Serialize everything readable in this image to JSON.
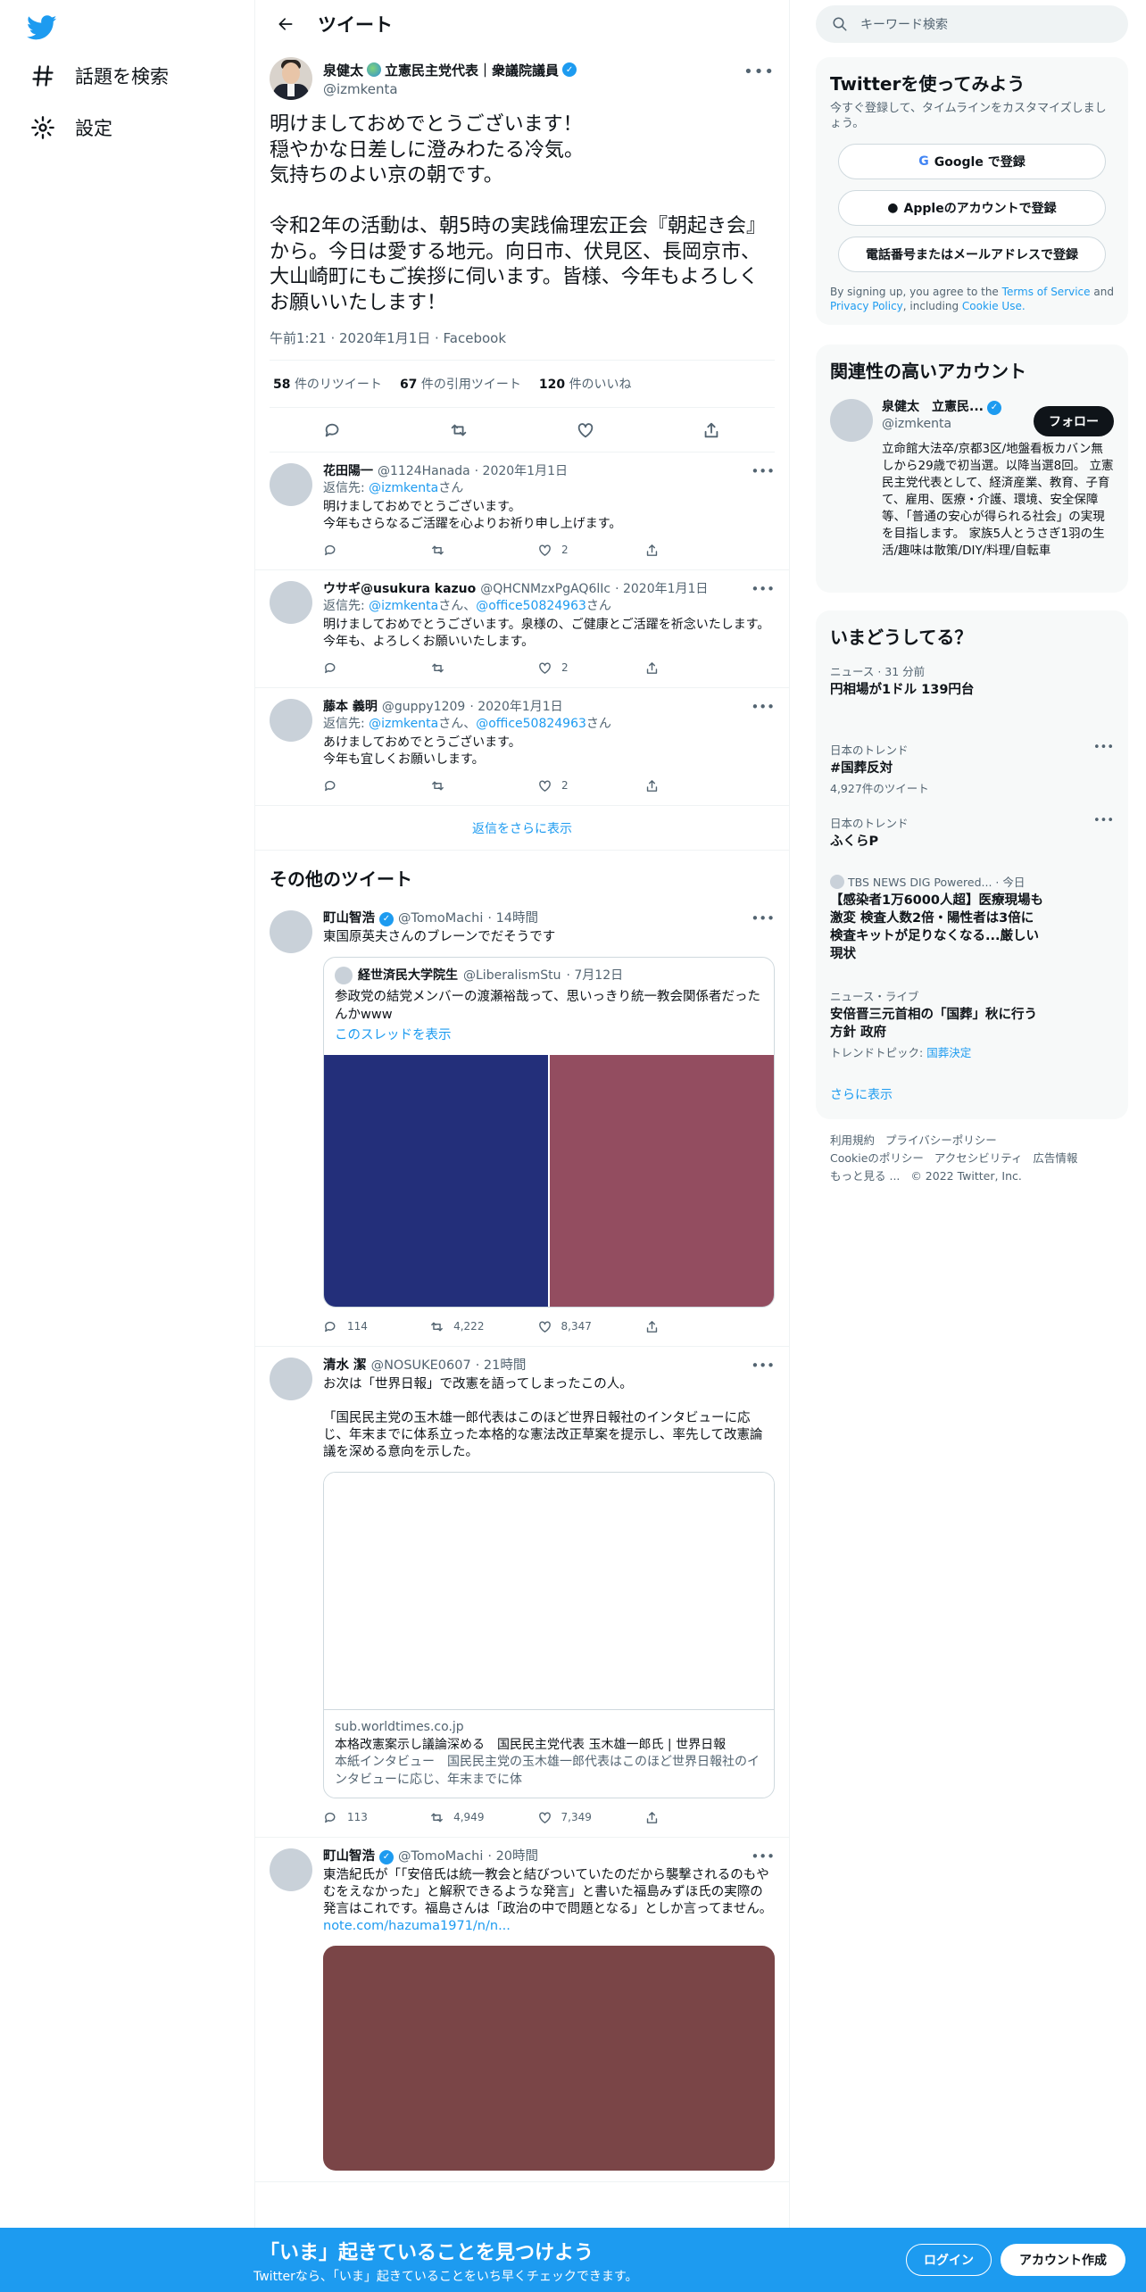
{
  "nav": {
    "explore_label": "話題を検索",
    "settings_label": "設定"
  },
  "header": {
    "title": "ツイート"
  },
  "main_tweet": {
    "name": "泉健太",
    "name_suffix": "立憲民主党代表｜衆議院議員",
    "handle": "@izmkenta",
    "text": "明けましておめでとうございます！\n穏やかな日差しに澄みわたる冷気。\n気持ちのよい京の朝です。\n\n令和2年の活動は、朝5時の実践倫理宏正会『朝起き会』から。今日は愛する地元。向日市、伏見区、長岡京市、大山崎町にもご挨拶に伺います。皆様、今年もよろしくお願いいたします！",
    "time": "午前1:21 · 2020年1月1日 · Facebook",
    "retweets": "58",
    "retweets_label": "件のリツイート",
    "quotes": "67",
    "quotes_label": "件の引用ツイート",
    "likes": "120",
    "likes_label": "件のいいね"
  },
  "replies": [
    {
      "name": "花田陽一",
      "handle": "@1124Hanada",
      "date": "· 2020年1月1日",
      "reply_to_label": "返信先:",
      "reply_to_1": "@izmkenta",
      "reply_to_2": "",
      "text": "明けましておめでとうございます。\n今年もさらなるご活躍を心よりお祈り申し上げます。",
      "likes": "2"
    },
    {
      "name": "ウサギ@usukura kazuo",
      "handle": "@QHCNMzxPgAQ6lIc",
      "date": "· 2020年1月1日",
      "reply_to_label": "返信先:",
      "reply_to_1": "@izmkenta",
      "reply_to_2": "@office50824963",
      "text": "明けましておめでとうございます。泉様の、ご健康とご活躍を祈念いたします。今年も、よろしくお願いいたします。",
      "likes": "2"
    },
    {
      "name": "藤本 義明",
      "handle": "@guppy1209",
      "date": "· 2020年1月1日",
      "reply_to_label": "返信先:",
      "reply_to_1": "@izmkenta",
      "reply_to_2": "@office50824963",
      "text": "あけましておめでとうございます。\n今年も宜しくお願いします。",
      "likes": "2"
    }
  ],
  "reply_suffix": "さん",
  "reply_and": "、",
  "show_more_replies": "返信をさらに表示",
  "other_tweets_title": "その他のツイート",
  "other_tweets": [
    {
      "name": "町山智浩",
      "handle": "@TomoMachi",
      "time": "· 14時間",
      "text": "東国原英夫さんのブレーンでだそうです",
      "quote_name": "経世済民大学院生",
      "quote_handle": "@LiberalismStu",
      "quote_date": "· 7月12日",
      "quote_text": "参政党の結党メンバーの渡瀬裕哉って、思いっきり統一教会関係者だったんかwww",
      "quote_link": "このスレッドを表示",
      "img1_color": "#232f7a",
      "img2_color": "#934d60",
      "replies": "114",
      "retweets": "4,222",
      "likes": "8,347"
    },
    {
      "name": "清水 潔",
      "handle": "@NOSUKE0607",
      "time": "· 21時間",
      "text": "お次は「世界日報」で改憲を語ってしまったこの人。\n\n「国民民主党の玉木雄一郎代表はこのほど世界日報社のインタビューに応じ、年末までに体系立った本格的な憲法改正草案を提示し、率先して改憲論議を深める意向を示した。",
      "card_domain": "sub.worldtimes.co.jp",
      "card_title": "本格改憲案示し議論深める　国民民主党代表 玉木雄一郎氏 | 世界日報",
      "card_desc": "本紙インタビュー　国民民主党の玉木雄一郎代表はこのほど世界日報社のインタビューに応じ、年末までに体",
      "replies": "113",
      "retweets": "4,949",
      "likes": "7,349"
    },
    {
      "name": "町山智浩",
      "handle": "@TomoMachi",
      "time": "· 20時間",
      "text": "東浩紀氏が「「安倍氏は統一教会と結びついていたのだから襲撃されるのもやむをえなかった」と解釈できるような発言」と書いた福島みずほ氏の実際の発言はこれです。福島さんは「政治の中で問題となる」としか言ってません。",
      "link": "note.com/hazuma1971/n/n...",
      "img_color": "#7a4547"
    }
  ],
  "right": {
    "search_placeholder": "キーワード検索",
    "signup_title": "Twitterを使ってみよう",
    "signup_sub": "今すぐ登録して、タイムラインをカスタマイズしましょう。",
    "google_btn": "Google で登録",
    "apple_btn": "Appleのアカウントで登録",
    "phone_btn": "電話番号またはメールアドレスで登録",
    "legal_1": "By signing up, you agree to the",
    "terms": "Terms of Service",
    "legal_2": "and",
    "privacy": "Privacy Policy",
    "legal_3": ", including",
    "cookie": "Cookie Use.",
    "relevant_title": "関連性の高いアカウント",
    "rel_name": "泉健太　立憲民...",
    "rel_handle": "@izmkenta",
    "rel_follow": "フォロー",
    "rel_bio": "立命館大法卒/京都3区/地盤看板カバン無しから29歳で初当選。以降当選8回。 立憲民主党代表として、経済産業、教育、子育て、雇用、医療・介護、環境、安全保障等、「普通の安心が得られる社会」の実現　を目指します。 家族5人とうさぎ1羽の生活/趣味は散策/DIY/料理/自転車",
    "trends_title": "いまどうしてる？",
    "trends": [
      {
        "context": "ニュース · 31 分前",
        "title": "円相場が1ドル 139円台",
        "meta": ""
      },
      {
        "context": "日本のトレンド",
        "title": "#国葬反対",
        "meta": "4,927件のツイート"
      },
      {
        "context": "日本のトレンド",
        "title": "ふくらP",
        "meta": ""
      },
      {
        "context": "TBS NEWS DIG Powered... · 今日",
        "title": "【感染者1万6000人超】医療現場も激変 検査人数2倍・陽性者は3倍に 検査キットが足りなくなる...厳しい現状",
        "meta": ""
      },
      {
        "context": "ニュース・ライブ",
        "title": "安倍晋三元首相の「国葬」秋に行う方針 政府",
        "meta_label": "トレンドトピック:",
        "meta_link": "国葬決定"
      }
    ],
    "show_more": "さらに表示",
    "footer_links": [
      "利用規約",
      "プライバシーポリシー",
      "Cookieのポリシー",
      "アクセシビリティ",
      "広告情報",
      "もっと見る ...",
      "© 2022 Twitter, Inc."
    ]
  },
  "bottom": {
    "title": "「いま」起きていることを見つけよう",
    "subtitle": "Twitterなら、「いま」起きていることをいち早くチェックできます。",
    "login": "ログイン",
    "signup": "アカウント作成"
  },
  "colors": {
    "accent": "#1d9bf0",
    "text": "#0f1419",
    "muted": "#536471"
  }
}
